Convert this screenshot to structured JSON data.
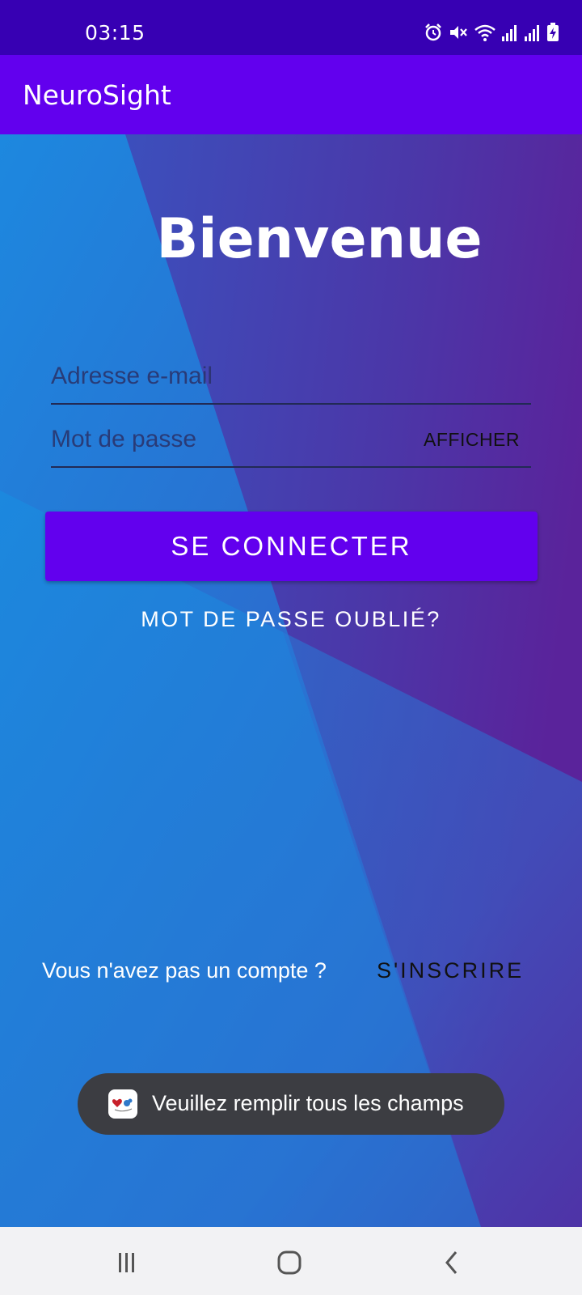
{
  "status_bar": {
    "time": "03:15",
    "icons": [
      "alarm-icon",
      "mute-icon",
      "wifi-icon",
      "signal-icon",
      "signal-icon-2",
      "battery-charging-icon"
    ]
  },
  "app_bar": {
    "title": "NeuroSight"
  },
  "login": {
    "welcome": "Bienvenue",
    "email_placeholder": "Adresse e-mail",
    "email_value": "",
    "password_placeholder": "Mot de passe",
    "password_value": "",
    "show_password_label": "AFFICHER",
    "login_button": "SE CONNECTER",
    "forgot_password": "MOT DE PASSE OUBLIÉ?",
    "no_account_text": "Vous n'avez pas un compte ?",
    "signup_button": "S'INSCRIRE"
  },
  "toast": {
    "message": "Veuillez remplir tous les champs"
  },
  "nav_bar": {
    "buttons": [
      "recent-apps-icon",
      "home-icon",
      "back-icon"
    ]
  },
  "colors": {
    "status_bar": "#3700b3",
    "primary": "#6200ee",
    "toast_bg": "#3c3d42",
    "nav_bg": "#f2f2f4"
  }
}
